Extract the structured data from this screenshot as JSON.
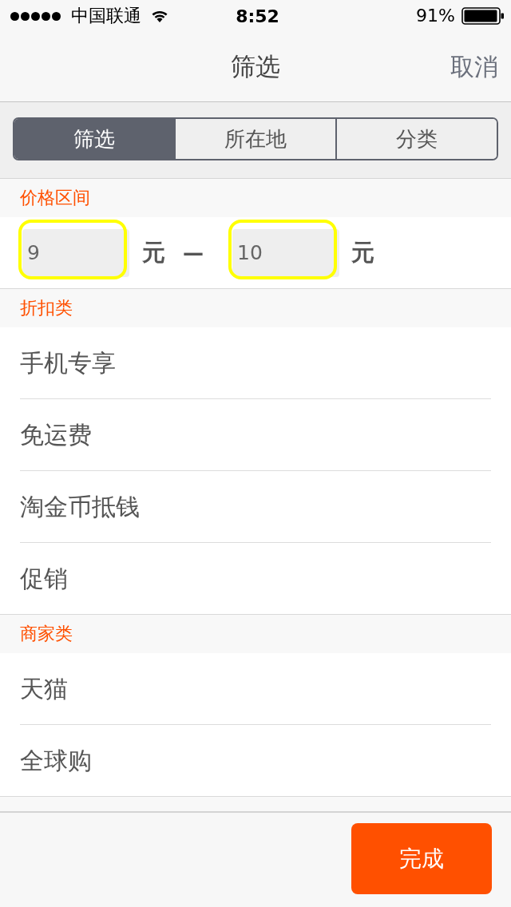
{
  "status_bar": {
    "carrier": "中国联通",
    "time": "8:52",
    "battery": "91%"
  },
  "nav_bar": {
    "title": "筛选",
    "cancel": "取消"
  },
  "segments": [
    {
      "label": "筛选",
      "selected": true
    },
    {
      "label": "所在地",
      "selected": false
    },
    {
      "label": "分类",
      "selected": false
    }
  ],
  "price_range": {
    "title": "价格区间",
    "min": {
      "value": "9",
      "highlighted": true
    },
    "unit_min": "元",
    "separator": "—",
    "max": {
      "value": "10",
      "highlighted": true
    },
    "unit_max": "元"
  },
  "sections": [
    {
      "title": "折扣类",
      "items": [
        {
          "label": "手机专享",
          "selected": false
        },
        {
          "label": "免运费",
          "selected": false
        },
        {
          "label": "淘金币抵钱",
          "selected": false
        },
        {
          "label": "促销",
          "selected": false
        }
      ]
    },
    {
      "title": "商家类",
      "items": [
        {
          "label": "天猫",
          "selected": false
        },
        {
          "label": "全球购",
          "selected": false
        }
      ]
    }
  ],
  "done_button": "完成"
}
